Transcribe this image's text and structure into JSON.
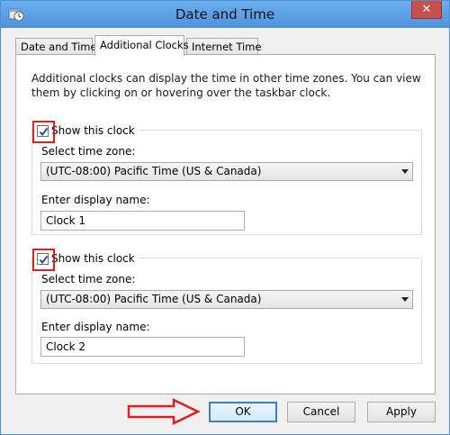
{
  "window": {
    "title": "Date and Time",
    "close_label": "✕",
    "icon": "clock-calendar-icon"
  },
  "tabs": [
    {
      "label": "Date and Time",
      "active": false
    },
    {
      "label": "Additional Clocks",
      "active": true
    },
    {
      "label": "Internet Time",
      "active": false
    }
  ],
  "intro_text": "Additional clocks can display the time in other time zones. You can view them by clicking on or hovering over the taskbar clock.",
  "clocks": [
    {
      "show_label": "Show this clock",
      "checked": true,
      "timezone_label": "Select time zone:",
      "timezone_value": "(UTC-08:00) Pacific Time (US & Canada)",
      "name_label": "Enter display name:",
      "name_value": "Clock 1"
    },
    {
      "show_label": "Show this clock",
      "checked": true,
      "timezone_label": "Select time zone:",
      "timezone_value": "(UTC-08:00) Pacific Time (US & Canada)",
      "name_label": "Enter display name:",
      "name_value": "Clock 2"
    }
  ],
  "buttons": {
    "ok": "OK",
    "cancel": "Cancel",
    "apply": "Apply"
  },
  "colors": {
    "titlebar": "#5ba0e6",
    "annotation": "#e02020",
    "close": "#c7504b"
  }
}
